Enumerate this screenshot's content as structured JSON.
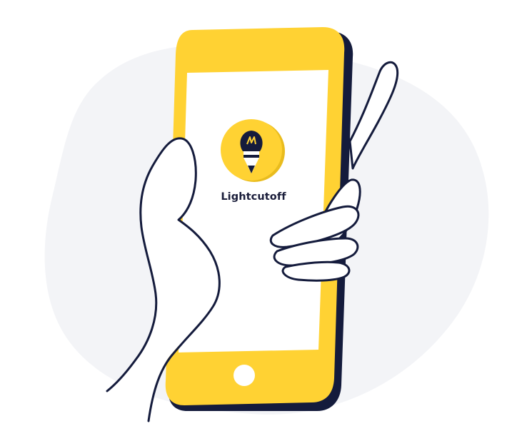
{
  "app": {
    "brand_name": "Lightcutoff",
    "logo_icon": "lightbulb-pencil-icon"
  },
  "colors": {
    "phone_body": "#FFD233",
    "phone_shadow": "#141B3C",
    "screen": "#FFFFFF",
    "home_button": "#FFFFFF",
    "logo_circle": "#FFD233",
    "logo_glyph": "#141B3C",
    "backdrop_blob": "#F3F4F7",
    "hand_fill": "#FFFFFF",
    "hand_outline": "#141B3C"
  },
  "icons": {
    "home_button": "home-button-icon",
    "hands": "holding-hand-illustration"
  }
}
